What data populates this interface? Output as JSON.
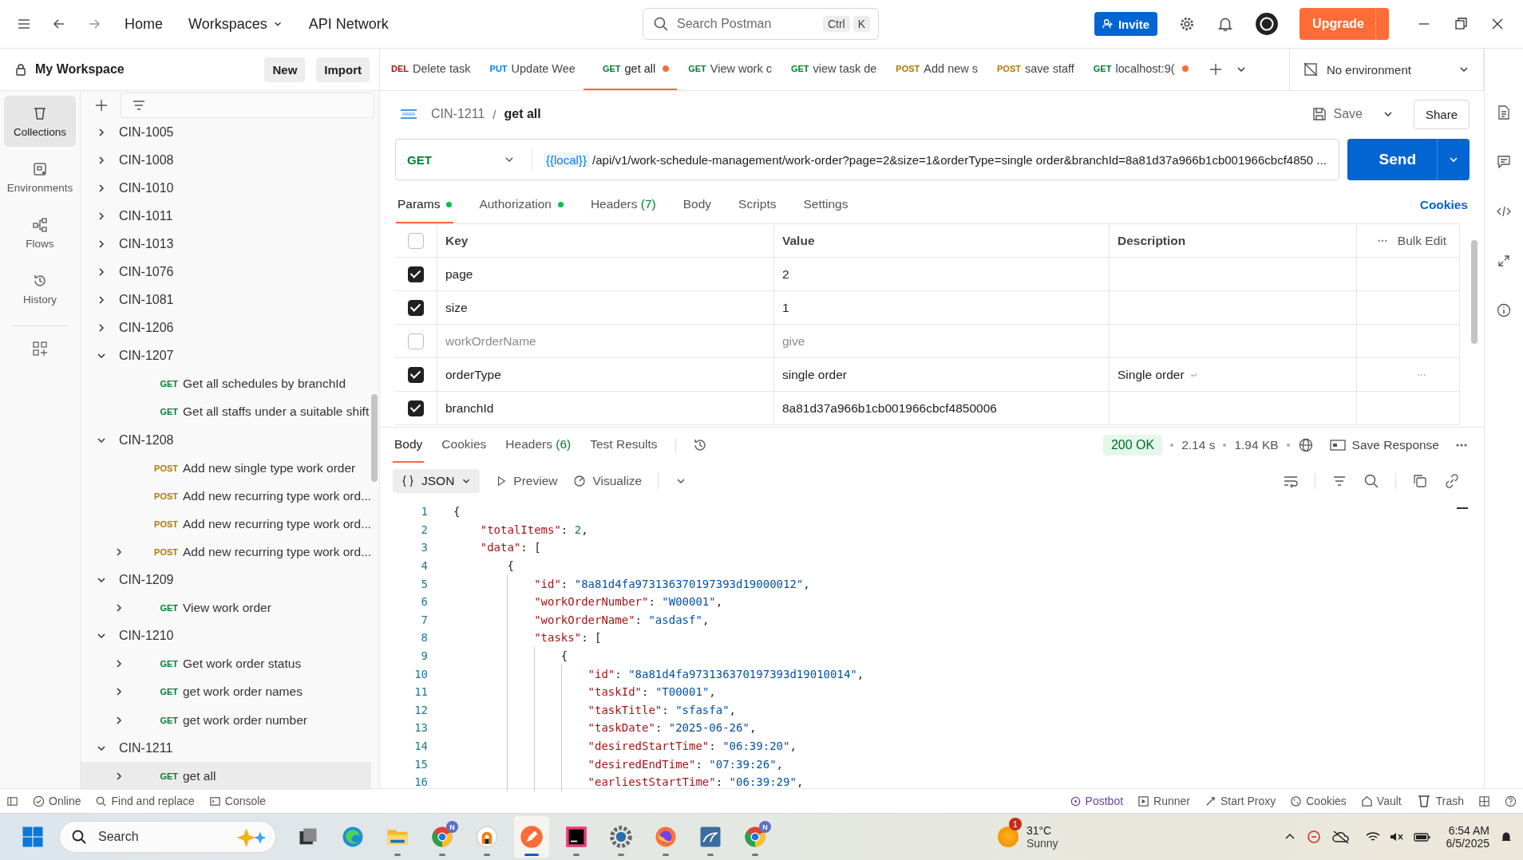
{
  "top_bar": {
    "nav": [
      "Home",
      "Workspaces",
      "API Network"
    ],
    "search": {
      "placeholder": "Search Postman",
      "keys": [
        "Ctrl",
        "K"
      ]
    },
    "invite": "Invite",
    "upgrade": "Upgrade"
  },
  "workspace": {
    "name": "My Workspace",
    "buttons": [
      "New",
      "Import"
    ]
  },
  "rail": [
    {
      "label": "Collections",
      "selected": true
    },
    {
      "label": "Environments",
      "selected": false
    },
    {
      "label": "Flows",
      "selected": false
    },
    {
      "label": "History",
      "selected": false
    }
  ],
  "tree": [
    {
      "kind": "folder",
      "label": "CIN-1005",
      "expanded": false
    },
    {
      "kind": "folder",
      "label": "CIN-1008",
      "expanded": false
    },
    {
      "kind": "folder",
      "label": "CIN-1010",
      "expanded": false
    },
    {
      "kind": "folder",
      "label": "CIN-1011",
      "expanded": false
    },
    {
      "kind": "folder",
      "label": "CIN-1013",
      "expanded": false
    },
    {
      "kind": "folder",
      "label": "CIN-1076",
      "expanded": false
    },
    {
      "kind": "folder",
      "label": "CIN-1081",
      "expanded": false
    },
    {
      "kind": "folder",
      "label": "CIN-1206",
      "expanded": false
    },
    {
      "kind": "folder",
      "label": "CIN-1207",
      "expanded": true,
      "children": [
        {
          "kind": "request",
          "method": "GET",
          "name": "Get all schedules by branchId",
          "expandable": false,
          "selected": false
        },
        {
          "kind": "request",
          "method": "GET",
          "name": "Get all staffs under a suitable shift",
          "expandable": false,
          "selected": false
        }
      ]
    },
    {
      "kind": "folder",
      "label": "CIN-1208",
      "expanded": true,
      "children": [
        {
          "kind": "request",
          "method": "POST",
          "name": "Add new single type work order",
          "expandable": false,
          "selected": false
        },
        {
          "kind": "request",
          "method": "POST",
          "name": "Add new recurring type work ord...",
          "expandable": false,
          "selected": false
        },
        {
          "kind": "request",
          "method": "POST",
          "name": "Add new recurring type work ord...",
          "expandable": false,
          "selected": false
        },
        {
          "kind": "request",
          "method": "POST",
          "name": "Add new recurring type work ord...",
          "expandable": true,
          "selected": false
        }
      ]
    },
    {
      "kind": "folder",
      "label": "CIN-1209",
      "expanded": true,
      "children": [
        {
          "kind": "request",
          "method": "GET",
          "name": "View work order",
          "expandable": true,
          "selected": false
        }
      ]
    },
    {
      "kind": "folder",
      "label": "CIN-1210",
      "expanded": true,
      "children": [
        {
          "kind": "request",
          "method": "GET",
          "name": "Get work order status",
          "expandable": true,
          "selected": false
        },
        {
          "kind": "request",
          "method": "GET",
          "name": "get work order names",
          "expandable": true,
          "selected": false
        },
        {
          "kind": "request",
          "method": "GET",
          "name": "get work order number",
          "expandable": true,
          "selected": false
        }
      ]
    },
    {
      "kind": "folder",
      "label": "CIN-1211",
      "expanded": true,
      "children": [
        {
          "kind": "request",
          "method": "GET",
          "name": "get all",
          "expandable": true,
          "selected": true
        }
      ]
    }
  ],
  "tabs": [
    {
      "method": "DEL",
      "name": "Delete task",
      "selected": false,
      "unsaved": false
    },
    {
      "method": "PUT",
      "name": "Update Wee",
      "selected": false,
      "unsaved": false
    },
    {
      "method": "GET",
      "name": "get all",
      "selected": true,
      "unsaved": true
    },
    {
      "method": "GET",
      "name": "View work c",
      "selected": false,
      "unsaved": false
    },
    {
      "method": "GET",
      "name": "view task de",
      "selected": false,
      "unsaved": false
    },
    {
      "method": "POST",
      "name": "Add new s",
      "selected": false,
      "unsaved": false
    },
    {
      "method": "POST",
      "name": "save staff",
      "selected": false,
      "unsaved": false
    },
    {
      "method": "GET",
      "name": "localhost:9(",
      "selected": false,
      "unsaved": true
    }
  ],
  "environment": "No environment",
  "breadcrumb": {
    "folder": "CIN-1211",
    "separator": "/",
    "request": "get all"
  },
  "actions": {
    "save": "Save",
    "share": "Share"
  },
  "request": {
    "method": "GET",
    "variable": "{{local}}",
    "url": "/api/v1/work-schedule-management/work-order?page=2&size=1&orderType=single order&branchId=8a81d37a966b1cb001966cbcf4850 ...",
    "send": "Send"
  },
  "request_tabs": [
    {
      "label": "Params",
      "dot": true,
      "selected": true
    },
    {
      "label": "Authorization",
      "dot": true,
      "selected": false
    },
    {
      "label": "Headers",
      "count": "(7)",
      "dot": false,
      "selected": false
    },
    {
      "label": "Body",
      "dot": false,
      "selected": false
    },
    {
      "label": "Scripts",
      "dot": false,
      "selected": false
    },
    {
      "label": "Settings",
      "dot": false,
      "selected": false
    }
  ],
  "cookies_link": "Cookies",
  "params": {
    "columns": [
      "Key",
      "Value",
      "Description"
    ],
    "bulk_edit": "Bulk Edit",
    "header_checked": false,
    "rows": [
      {
        "checked": true,
        "key": "page",
        "value": "2"
      },
      {
        "checked": true,
        "key": "size",
        "value": "1"
      },
      {
        "checked": false,
        "key": "workOrderName",
        "value": "give"
      },
      {
        "checked": true,
        "key": "orderType",
        "value": "single order",
        "description": "Single order"
      },
      {
        "checked": true,
        "key": "branchId",
        "value": "8a81d37a966b1cb001966cbcf4850006"
      }
    ]
  },
  "response": {
    "tabs": [
      {
        "label": "Body",
        "selected": true
      },
      {
        "label": "Cookies",
        "selected": false
      },
      {
        "label": "Headers",
        "count": "(6)",
        "selected": false
      },
      {
        "label": "Test Results",
        "selected": false
      }
    ],
    "status": "200 OK",
    "time": "2.14 s",
    "size": "1.94 KB",
    "save_response": "Save Response",
    "format": "JSON",
    "views": [
      "Preview",
      "Visualize"
    ],
    "lines": [
      {
        "number": "1",
        "tokens": [
          {
            "kind": "punct",
            "text": "{"
          }
        ]
      },
      {
        "number": "2",
        "tokens": [
          {
            "kind": "key",
            "text": "    \"totalItems\""
          },
          {
            "kind": "punct",
            "text": ": "
          },
          {
            "kind": "number",
            "text": "2"
          },
          {
            "kind": "punct",
            "text": ","
          }
        ]
      },
      {
        "number": "3",
        "tokens": [
          {
            "kind": "key",
            "text": "    \"data\""
          },
          {
            "kind": "punct",
            "text": ": ["
          }
        ]
      },
      {
        "number": "4",
        "tokens": [
          {
            "kind": "punct",
            "text": "        {"
          }
        ]
      },
      {
        "number": "5",
        "tokens": [
          {
            "kind": "key",
            "text": "            \"id\""
          },
          {
            "kind": "punct",
            "text": ": "
          },
          {
            "kind": "string",
            "text": "\"8a81d4fa973136370197393d19000012\""
          },
          {
            "kind": "punct",
            "text": ","
          }
        ]
      },
      {
        "number": "6",
        "tokens": [
          {
            "kind": "key",
            "text": "            \"workOrderNumber\""
          },
          {
            "kind": "punct",
            "text": ": "
          },
          {
            "kind": "string",
            "text": "\"W00001\""
          },
          {
            "kind": "punct",
            "text": ","
          }
        ]
      },
      {
        "number": "7",
        "tokens": [
          {
            "kind": "key",
            "text": "            \"workOrderName\""
          },
          {
            "kind": "punct",
            "text": ": "
          },
          {
            "kind": "string",
            "text": "\"asdasf\""
          },
          {
            "kind": "punct",
            "text": ","
          }
        ]
      },
      {
        "number": "8",
        "tokens": [
          {
            "kind": "key",
            "text": "            \"tasks\""
          },
          {
            "kind": "punct",
            "text": ": ["
          }
        ]
      },
      {
        "number": "9",
        "tokens": [
          {
            "kind": "punct",
            "text": "                {"
          }
        ]
      },
      {
        "number": "10",
        "tokens": [
          {
            "kind": "key",
            "text": "                    \"id\""
          },
          {
            "kind": "punct",
            "text": ": "
          },
          {
            "kind": "string",
            "text": "\"8a81d4fa973136370197393d19010014\""
          },
          {
            "kind": "punct",
            "text": ","
          }
        ]
      },
      {
        "number": "11",
        "tokens": [
          {
            "kind": "key",
            "text": "                    \"taskId\""
          },
          {
            "kind": "punct",
            "text": ": "
          },
          {
            "kind": "string",
            "text": "\"T00001\""
          },
          {
            "kind": "punct",
            "text": ","
          }
        ]
      },
      {
        "number": "12",
        "tokens": [
          {
            "kind": "key",
            "text": "                    \"taskTitle\""
          },
          {
            "kind": "punct",
            "text": ": "
          },
          {
            "kind": "string",
            "text": "\"sfasfa\""
          },
          {
            "kind": "punct",
            "text": ","
          }
        ]
      },
      {
        "number": "13",
        "tokens": [
          {
            "kind": "key",
            "text": "                    \"taskDate\""
          },
          {
            "kind": "punct",
            "text": ": "
          },
          {
            "kind": "string",
            "text": "\"2025-06-26\""
          },
          {
            "kind": "punct",
            "text": ","
          }
        ]
      },
      {
        "number": "14",
        "tokens": [
          {
            "kind": "key",
            "text": "                    \"desiredStartTime\""
          },
          {
            "kind": "punct",
            "text": ": "
          },
          {
            "kind": "string",
            "text": "\"06:39:20\""
          },
          {
            "kind": "punct",
            "text": ","
          }
        ]
      },
      {
        "number": "15",
        "tokens": [
          {
            "kind": "key",
            "text": "                    \"desiredEndTime\""
          },
          {
            "kind": "punct",
            "text": ": "
          },
          {
            "kind": "string",
            "text": "\"07:39:26\""
          },
          {
            "kind": "punct",
            "text": ","
          }
        ]
      },
      {
        "number": "16",
        "tokens": [
          {
            "kind": "key",
            "text": "                    \"earliestStartTime\""
          },
          {
            "kind": "punct",
            "text": ": "
          },
          {
            "kind": "string",
            "text": "\"06:39:29\""
          },
          {
            "kind": "punct",
            "text": ","
          }
        ]
      }
    ]
  },
  "status_bar": {
    "left": [
      "Online",
      "Find and replace",
      "Console"
    ],
    "right": [
      "Postbot",
      "Runner",
      "Start Proxy",
      "Cookies",
      "Vault",
      "Trash"
    ]
  },
  "taskbar": {
    "search": "Search",
    "apps": [
      {
        "kind": "taskview",
        "running": false,
        "active": false
      },
      {
        "kind": "browser",
        "running": false,
        "active": false
      },
      {
        "kind": "folder",
        "running": true,
        "active": false
      },
      {
        "kind": "chrome",
        "running": true,
        "active": false,
        "badge": "N"
      },
      {
        "kind": "vpn",
        "running": true,
        "active": false
      },
      {
        "kind": "postman",
        "running": true,
        "active": true
      },
      {
        "kind": "ide",
        "running": true,
        "active": false
      },
      {
        "kind": "settings",
        "running": true,
        "active": false
      },
      {
        "kind": "firefox",
        "running": true,
        "active": false
      },
      {
        "kind": "database",
        "running": true,
        "active": false
      },
      {
        "kind": "chrome",
        "running": true,
        "active": false,
        "badge": "N"
      }
    ],
    "weather": {
      "badge": "1",
      "temp": "31°C",
      "desc": "Sunny"
    },
    "time": "6:54 AM",
    "date": "6/5/2025"
  }
}
